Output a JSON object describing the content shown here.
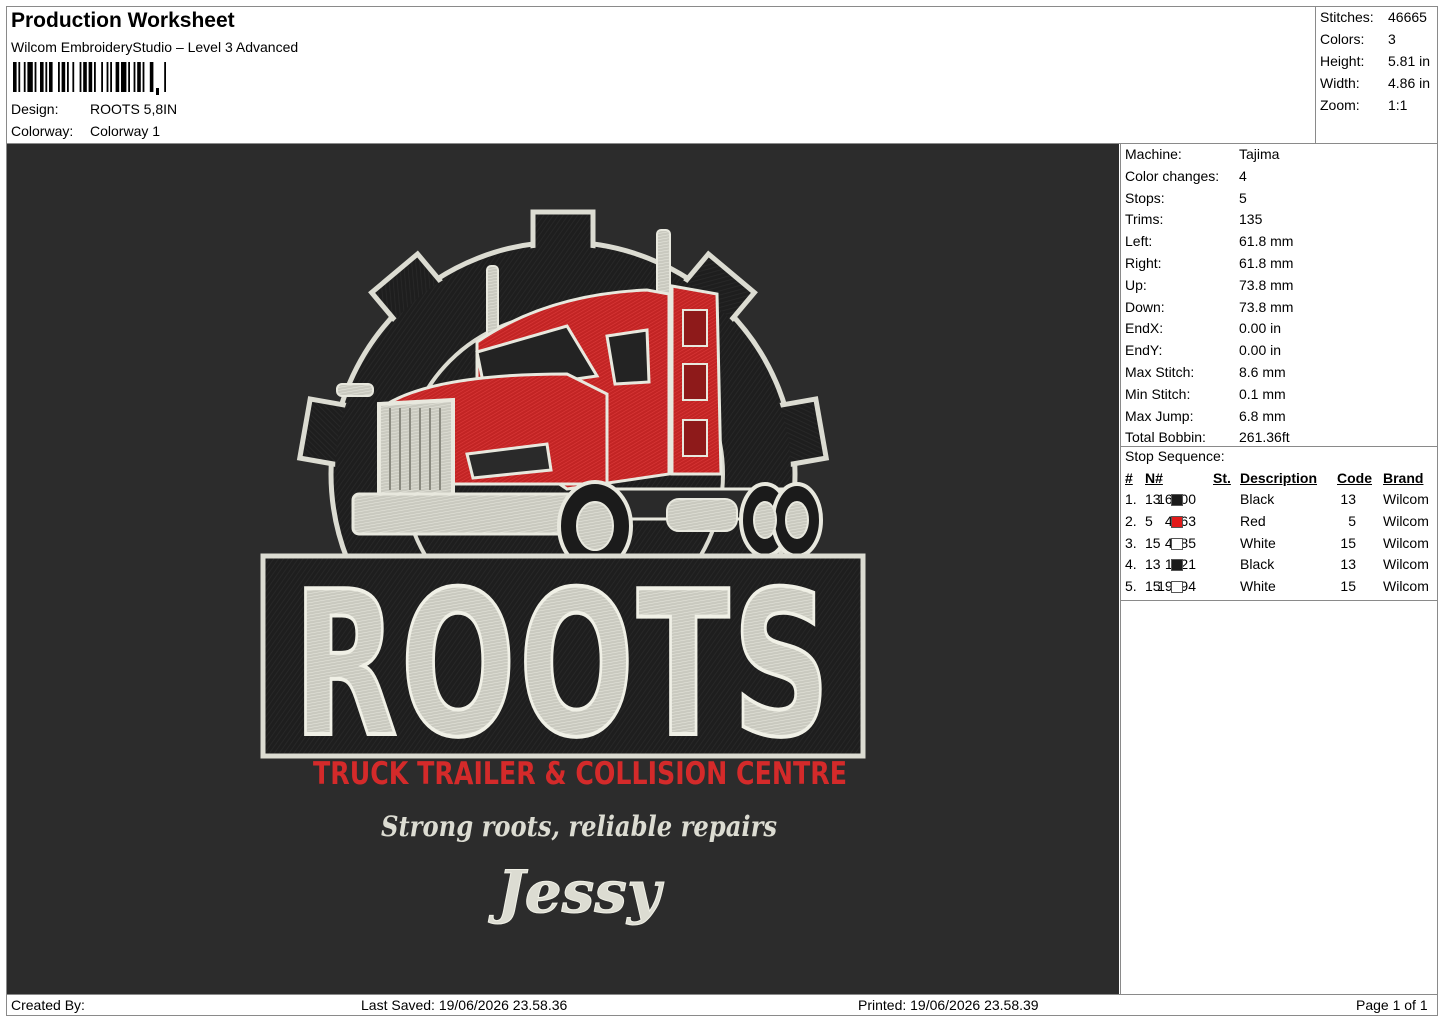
{
  "header": {
    "title": "Production Worksheet",
    "software": "Wilcom EmbroideryStudio – Level 3 Advanced",
    "design_label": "Design:",
    "design_value": "ROOTS 5,8IN",
    "colorway_label": "Colorway:",
    "colorway_value": "Colorway 1"
  },
  "stats": [
    {
      "label": "Stitches:",
      "value": "46665"
    },
    {
      "label": "Colors:",
      "value": "3"
    },
    {
      "label": "Height:",
      "value": "5.81 in"
    },
    {
      "label": "Width:",
      "value": "4.86 in"
    },
    {
      "label": "Zoom:",
      "value": "1:1"
    }
  ],
  "design": {
    "main_text": "ROOTS",
    "tagline_red": "TRUCK TRAILER & COLLISION CENTRE",
    "tagline": "Strong roots, reliable repairs",
    "name": "Jessy",
    "colors": {
      "background": "#2c2c2c",
      "thread_white": "#dcdcd2",
      "thread_red": "#d42a2a",
      "thread_black": "#1e1e1e"
    }
  },
  "machine": [
    {
      "label": "Machine:",
      "value": "Tajima"
    },
    {
      "label": "Color changes:",
      "value": "4"
    },
    {
      "label": "Stops:",
      "value": "5"
    },
    {
      "label": "Trims:",
      "value": "135"
    },
    {
      "label": "Left:",
      "value": "61.8 mm"
    },
    {
      "label": "Right:",
      "value": "61.8 mm"
    },
    {
      "label": "Up:",
      "value": "73.8 mm"
    },
    {
      "label": "Down:",
      "value": "73.8 mm"
    },
    {
      "label": "EndX:",
      "value": "0.00 in"
    },
    {
      "label": "EndY:",
      "value": "0.00 in"
    },
    {
      "label": "Max Stitch:",
      "value": "8.6 mm"
    },
    {
      "label": "Min Stitch:",
      "value": "0.1 mm"
    },
    {
      "label": "Max Jump:",
      "value": "6.8 mm"
    },
    {
      "label": "Total Bobbin:",
      "value": "261.36ft"
    }
  ],
  "stop_sequence": {
    "title": "Stop Sequence:",
    "headers": [
      "#",
      "N#",
      "St.",
      "Description",
      "Code",
      "Brand"
    ],
    "rows": [
      {
        "num": "1.",
        "n": "13",
        "color": "#1a1a1a",
        "st": "16500",
        "desc": "Black",
        "code": "13",
        "brand": "Wilcom"
      },
      {
        "num": "2.",
        "n": "5",
        "color": "#e21a1a",
        "st": "4163",
        "desc": "Red",
        "code": "5",
        "brand": "Wilcom"
      },
      {
        "num": "3.",
        "n": "15",
        "color": "#ffffff",
        "st": "4285",
        "desc": "White",
        "code": "15",
        "brand": "Wilcom"
      },
      {
        "num": "4.",
        "n": "13",
        "color": "#1a1a1a",
        "st": "1721",
        "desc": "Black",
        "code": "13",
        "brand": "Wilcom"
      },
      {
        "num": "5.",
        "n": "15",
        "color": "#ffffff",
        "st": "19994",
        "desc": "White",
        "code": "15",
        "brand": "Wilcom"
      }
    ]
  },
  "footer": {
    "created_by": "Created By:",
    "last_saved": "Last Saved: 19/06/2026 23.58.36",
    "printed": "Printed: 19/06/2026 23.58.39",
    "page": "Page 1 of 1"
  }
}
